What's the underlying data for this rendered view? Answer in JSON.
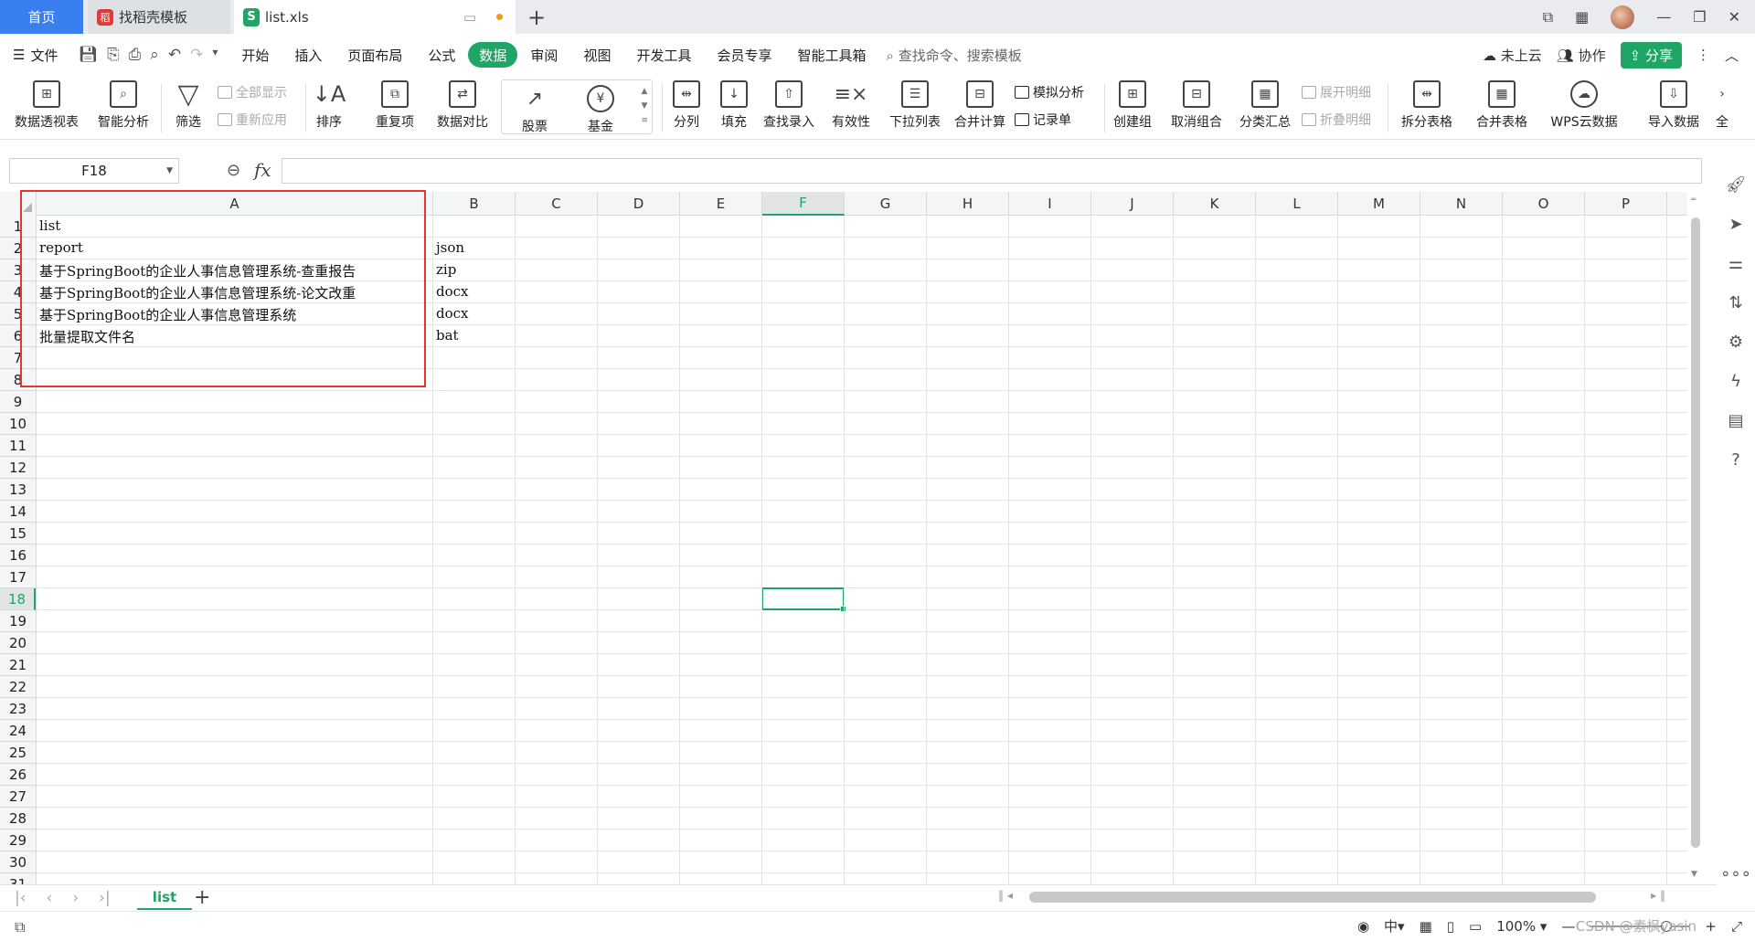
{
  "tabs": {
    "home": "首页",
    "template": "找稻壳模板",
    "file": "list.xls",
    "add": "+"
  },
  "menu": {
    "file": "文件",
    "items": [
      "开始",
      "插入",
      "页面布局",
      "公式",
      "数据",
      "审阅",
      "视图",
      "开发工具",
      "会员专享",
      "智能工具箱"
    ],
    "active": "数据",
    "search": "查找命令、搜索模板",
    "cloud": "未上云",
    "collab": "协作",
    "share": "分享"
  },
  "ribbon": {
    "pivot": "数据透视表",
    "smart_analysis": "智能分析",
    "filter": "筛选",
    "show_all": "全部显示",
    "reapply": "重新应用",
    "sort": "排序",
    "duplicates": "重复项",
    "compare": "数据对比",
    "stock": "股票",
    "fund": "基金",
    "split": "分列",
    "fill": "填充",
    "lookup": "查找录入",
    "validity": "有效性",
    "dropdown": "下拉列表",
    "consolidate": "合并计算",
    "simulate": "模拟分析",
    "record": "记录单",
    "create_group": "创建组",
    "ungroup": "取消组合",
    "subtotal": "分类汇总",
    "expand": "展开明细",
    "collapse": "折叠明细",
    "split_table": "拆分表格",
    "merge_table": "合并表格",
    "wps_cloud": "WPS云数据",
    "import": "导入数据",
    "more": "全"
  },
  "formula_bar": {
    "cell_ref": "F18",
    "fx": "fx",
    "value": ""
  },
  "columns": [
    "A",
    "B",
    "C",
    "D",
    "E",
    "F",
    "G",
    "H",
    "I",
    "J",
    "K",
    "L",
    "M",
    "N",
    "O",
    "P"
  ],
  "selected_column": "F",
  "rows": [
    "1",
    "2",
    "3",
    "4",
    "5",
    "6",
    "7",
    "8",
    "9",
    "10",
    "11",
    "12",
    "13",
    "14",
    "15",
    "16",
    "17",
    "18",
    "19",
    "20",
    "21",
    "22",
    "23",
    "24",
    "25",
    "26",
    "27",
    "28",
    "29",
    "30",
    "31"
  ],
  "selected_row": "18",
  "cells": [
    {
      "row": 1,
      "a": "list",
      "b": ""
    },
    {
      "row": 2,
      "a": "report",
      "b": "json"
    },
    {
      "row": 3,
      "a": "基于SpringBoot的企业人事信息管理系统-查重报告",
      "b": "zip"
    },
    {
      "row": 4,
      "a": "基于SpringBoot的企业人事信息管理系统-论文改重",
      "b": "docx"
    },
    {
      "row": 5,
      "a": "基于SpringBoot的企业人事信息管理系统",
      "b": "docx"
    },
    {
      "row": 6,
      "a": "批量提取文件名",
      "b": "bat"
    }
  ],
  "sheet_tabs": {
    "active": "list",
    "add": "+"
  },
  "status": {
    "zoom": "100%",
    "watermark": "CSDN @素枫yasin"
  },
  "colors": {
    "accent": "#1fa564",
    "home_tab": "#3a7ff0",
    "highlight_box": "#e03636"
  }
}
